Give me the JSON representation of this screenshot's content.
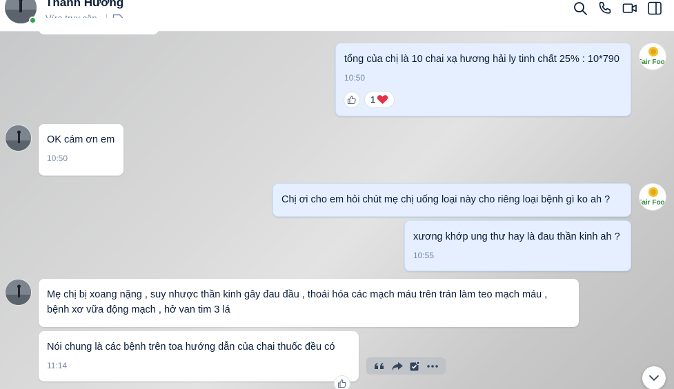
{
  "header": {
    "contact_name": "Thanh Hương",
    "status": "Vừa truy cập"
  },
  "messages": [
    {
      "side": "me",
      "text": "tổng của chị là 10 chai xạ hương hải ly tinh chất 25% : 10*790",
      "time": "10:50",
      "reaction_count": "1"
    },
    {
      "side": "them",
      "text": "OK cám ơn em",
      "time": "10:50"
    },
    {
      "side": "me",
      "text": "Chị ơi cho em hỏi chút mẹ chị uống loại này cho riêng loại bệnh gì ko ah ?"
    },
    {
      "side": "me",
      "text": "xương khớp ung thư hay là đau thần kinh ah ?",
      "time": "10:55"
    },
    {
      "side": "them",
      "text_line1": "Mẹ chị bị xoang nặng , suy nhược thần kinh gây đau đầu , thoái hóa các mạch máu trên trán làm teo mạch máu ,",
      "text_line2": "bệnh xơ vữa động mạch , hở van tim 3 lá"
    },
    {
      "side": "them",
      "text": "Nói chung là các bệnh trên toa hướng dẫn của chai thuốc đều có",
      "time": "11:14"
    }
  ],
  "logo_text": "Fair Food",
  "icons": [
    "search-icon",
    "phone-icon",
    "video-call-icon",
    "sidebar-toggle-icon",
    "tag-icon",
    "like-icon",
    "heart-icon",
    "quote-icon",
    "share-icon",
    "task-icon",
    "more-icon",
    "chevron-down-icon"
  ],
  "colors": {
    "my_bubble": "#e5efff",
    "their_bubble": "#ffffff",
    "online": "#30a24d",
    "heart": "#e8304a"
  }
}
